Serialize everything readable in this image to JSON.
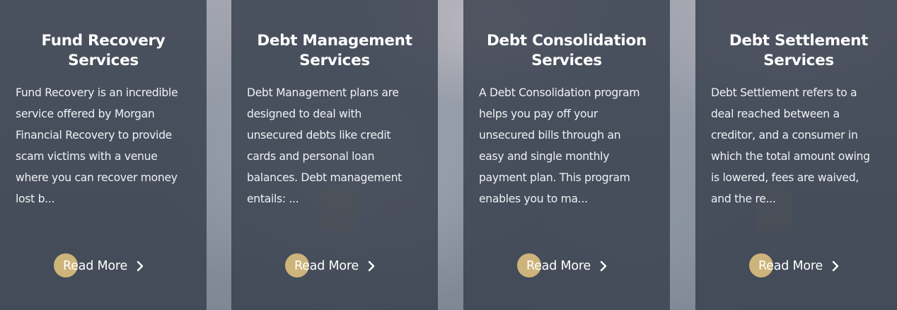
{
  "cards": [
    {
      "title": "Fund Recovery\nServices",
      "text": "Fund Recovery is an incredible\nservice offered by Morgan\nFinancial Recovery to provide\nscam victims with a venue\nwhere you can recover money\nlost b...",
      "read_more_label": "Read More"
    },
    {
      "title": "Debt Management\nServices",
      "text": "Debt Management plans are\ndesigned to deal with\nunsecured debts like credit\ncards and personal loan\nbalances. Debt management\nentails: ...",
      "read_more_label": "Read More"
    },
    {
      "title": "Debt Consolidation\nServices",
      "text": "A Debt Consolidation program\nhelps you pay off your\nunsecured bills through an\neasy and single monthly\npayment plan. This program\nenables you to ma...",
      "read_more_label": "Read More"
    },
    {
      "title": "Debt Settlement\nServices",
      "text": "Debt Settlement refers to a\ndeal reached between a\ncreditor, and a consumer in\nwhich the total amount owing\nis lowered, fees are waived,\nand the re...",
      "read_more_label": "Read More"
    }
  ],
  "colors": {
    "card_overlay": "#343c4a",
    "accent_dot": "#cdb47a",
    "text": "#ffffff"
  },
  "icons": {
    "read_more": "chevron-right-icon",
    "watermark": "watermark-logo-icon"
  }
}
